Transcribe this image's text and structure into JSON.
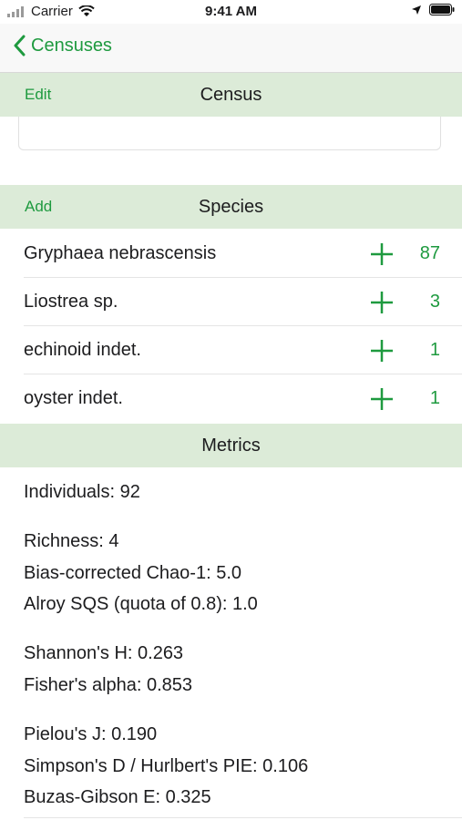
{
  "status_bar": {
    "carrier": "Carrier",
    "time": "9:41 AM"
  },
  "nav": {
    "back_label": "Censuses"
  },
  "census_section": {
    "title": "Census",
    "action": "Edit"
  },
  "species_section": {
    "title": "Species",
    "action": "Add",
    "items": [
      {
        "name": "Gryphaea nebrascensis",
        "count": "87"
      },
      {
        "name": "Liostrea sp.",
        "count": "3"
      },
      {
        "name": "echinoid indet.",
        "count": "1"
      },
      {
        "name": "oyster indet.",
        "count": "1"
      }
    ]
  },
  "metrics_section": {
    "title": "Metrics",
    "lines": [
      "Individuals: 92",
      "Richness: 4",
      "Bias-corrected Chao-1: 5.0",
      "Alroy SQS (quota of 0.8): 1.0",
      "Shannon's H: 0.263",
      "Fisher's alpha: 0.853",
      "Pielou's J: 0.190",
      "Simpson's D / Hurlbert's PIE: 0.106",
      "Buzas-Gibson E: 0.325"
    ]
  },
  "colors": {
    "accent": "#1e9a3f",
    "section_bg": "#dcebd8"
  }
}
